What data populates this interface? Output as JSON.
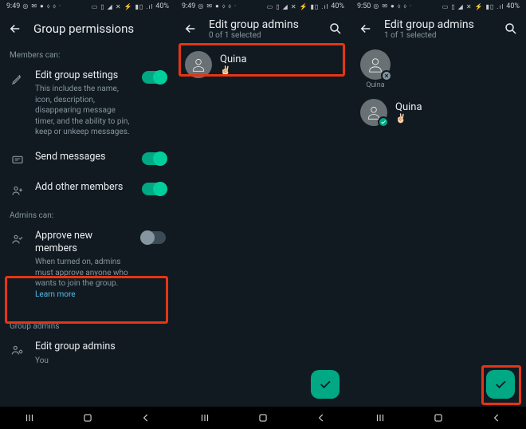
{
  "status": {
    "time_a": "9:49",
    "time_b": "9:49",
    "time_c": "9:50",
    "left_icons": "◎ ✉ ● ⬨ ⬨ ·",
    "right_icons": "▭ ▯ ◢ ✕ ⚡ ▮▯ .ıl",
    "battery": "40%"
  },
  "screen1": {
    "title": "Group permissions",
    "members_can": "Members can:",
    "edit_settings": {
      "title": "Edit group settings",
      "desc": "This includes the name, icon, description, disappearing message timer, and the ability to pin, keep or unkeep messages."
    },
    "send_messages": "Send messages",
    "add_members": "Add other members",
    "admins_can": "Admins can:",
    "approve": {
      "title": "Approve new members",
      "desc": "When turned on, admins must approve anyone who wants to join the group.",
      "learn": "Learn more"
    },
    "group_admins_label": "Group admins",
    "edit_admins": {
      "title": "Edit group admins",
      "sub": "You"
    }
  },
  "screen2": {
    "title": "Edit group admins",
    "subtitle": "0 of 1 selected",
    "contact": {
      "name": "Quina",
      "status": "✌🏻"
    }
  },
  "screen3": {
    "title": "Edit group admins",
    "subtitle": "1 of 1 selected",
    "selected": {
      "name": "Quina"
    },
    "contact": {
      "name": "Quina",
      "status": "✌🏻"
    }
  }
}
